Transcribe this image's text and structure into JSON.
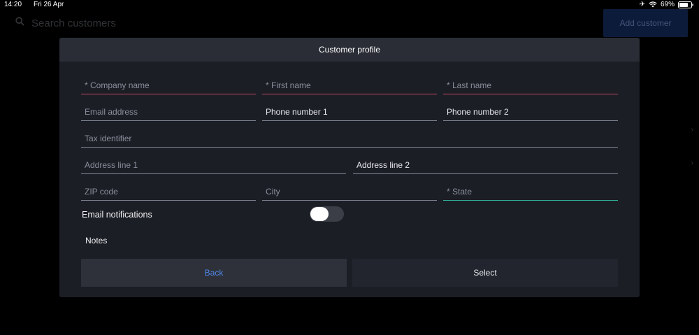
{
  "status_bar": {
    "time": "14:20",
    "date": "Fri 26 Apr",
    "battery": "69%",
    "icons": [
      "airplane-icon",
      "wifi-icon",
      "battery-icon"
    ]
  },
  "background": {
    "search_placeholder": "Search customers",
    "add_button": "Add customer"
  },
  "modal": {
    "title": "Customer profile",
    "fields": {
      "company_name": "* Company name",
      "first_name": "* First name",
      "last_name": "* Last name",
      "email": "Email address",
      "phone1": "Phone number 1",
      "phone2": "Phone number 2",
      "tax_id": "Tax identifier",
      "address1": "Address line 1",
      "address2": "Address line 2",
      "zip": "ZIP code",
      "city": "City",
      "state": "* State"
    },
    "email_notifications": {
      "label": "Email notifications",
      "enabled": false
    },
    "notes_label": "Notes",
    "buttons": {
      "back": "Back",
      "select": "Select"
    }
  },
  "colors": {
    "modal_bg": "#1c1e26",
    "header_bg": "#2a2d36",
    "required_underline": "#c0485d",
    "focused_underline": "#2fb39a",
    "accent_blue": "#4f86e6"
  }
}
